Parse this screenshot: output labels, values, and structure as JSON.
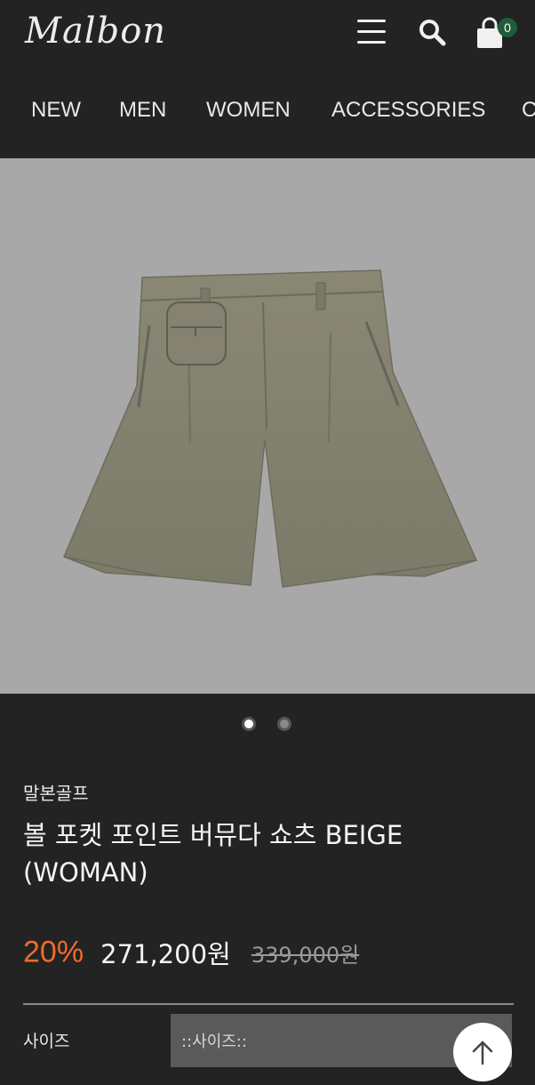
{
  "header": {
    "logo_text": "Malbon",
    "menu_icon": "hamburger-menu-icon",
    "search_icon": "search-icon",
    "cart_icon": "shopping-bag-icon",
    "cart_count": "0",
    "cart_badge_color": "#1f5c3a"
  },
  "nav": {
    "items": [
      "NEW",
      "MEN",
      "WOMEN",
      "ACCESSORIES",
      "C"
    ]
  },
  "gallery": {
    "background": "#a8a8a8",
    "image_subject": "beige-shorts-with-ball-pocket",
    "slide_count": 2,
    "active_slide": 1
  },
  "product": {
    "brand": "말본골프",
    "title": "볼 포켓 포인트 버뮤다 쇼츠 BEIGE (WOMAN)",
    "discount": "20%",
    "price": "271,200원",
    "original_price": "339,000원",
    "discount_color": "#f26a2a"
  },
  "options": {
    "size_label": "사이즈",
    "size_placeholder": "::사이즈::"
  },
  "scroll_top_icon": "arrow-up-icon"
}
